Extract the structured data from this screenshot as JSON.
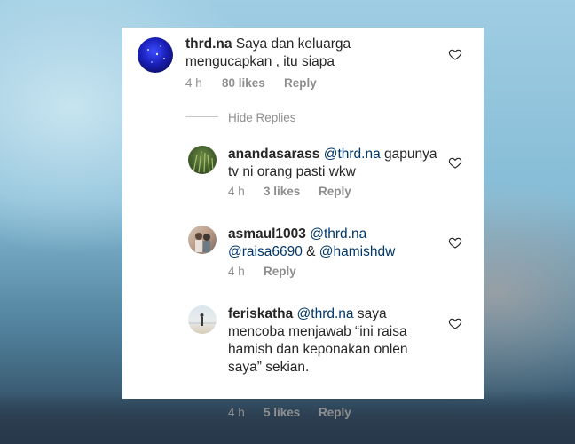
{
  "comments": [
    {
      "username": "thrd.na",
      "mention": "",
      "text": "Saya dan keluarga mengucapkan , itu siapa",
      "time": "4 h",
      "likes": "80 likes",
      "reply": "Reply",
      "avatar_icon": "starry-blue-avatar"
    },
    {
      "username": "anandasarass",
      "mention": "@thrd.na",
      "text": "gapunya tv ni orang pasti wkw",
      "time": "4 h",
      "likes": "3 likes",
      "reply": "Reply",
      "avatar_icon": "green-grass-avatar"
    },
    {
      "username": "asmaul1003",
      "mention": "@thrd.na",
      "mention2": "@raisa6690",
      "joiner": "&",
      "mention3": "@hamishdw",
      "time": "4 h",
      "likes": "",
      "reply": "Reply",
      "avatar_icon": "couple-photo-avatar"
    },
    {
      "username": "feriskatha",
      "mention": "@thrd.na",
      "text": "saya mencoba menjawab “ini raisa hamish dan keponakan onlen saya” sekian.",
      "time": "4 h",
      "likes": "5 likes",
      "reply": "Reply",
      "avatar_icon": "beach-photo-avatar"
    }
  ],
  "hide_replies": "Hide Replies",
  "like_icon": "heart-outline-icon",
  "colors": {
    "mention": "#00376b",
    "meta": "#8e8e8e",
    "text": "#262626"
  }
}
